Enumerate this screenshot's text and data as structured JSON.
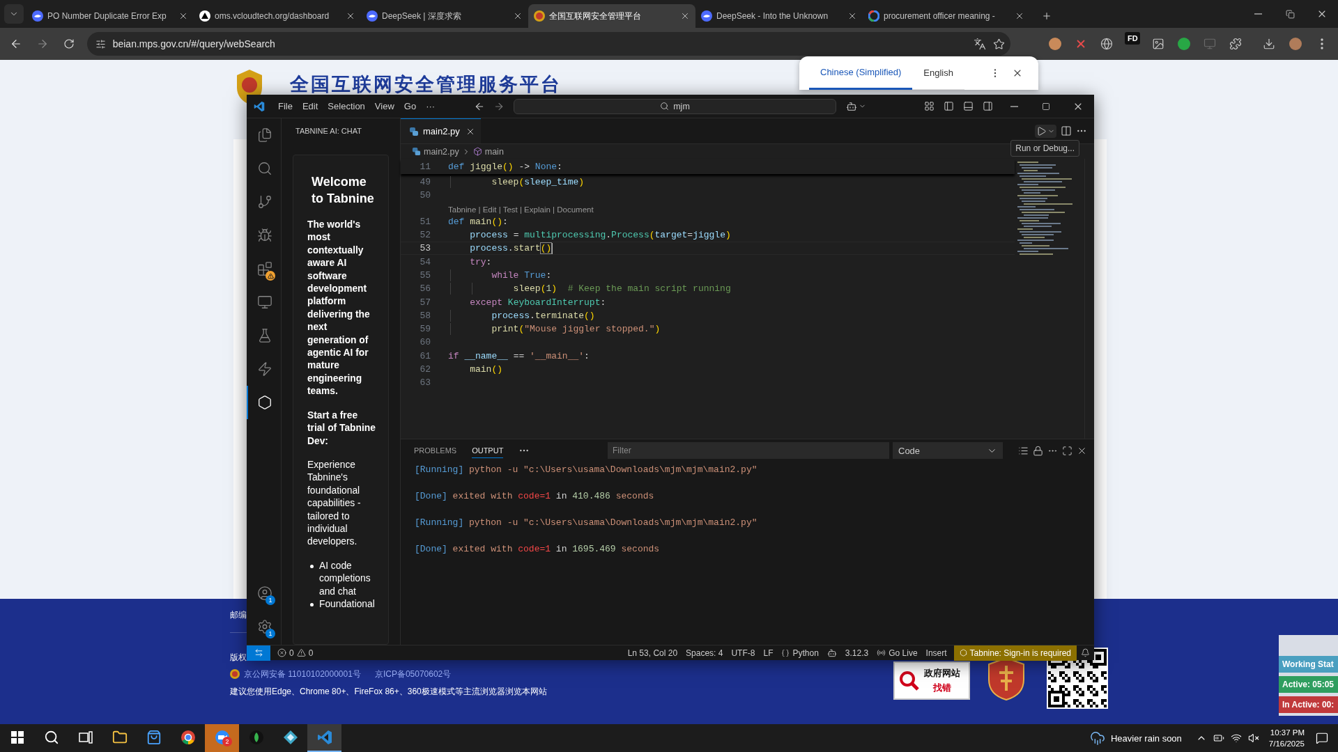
{
  "browser": {
    "tabs": [
      {
        "kind": "deepseek",
        "title": "PO Number Duplicate Error Exp",
        "selected": false
      },
      {
        "kind": "triangle",
        "title": "oms.vcloudtech.org/dashboard",
        "selected": false
      },
      {
        "kind": "deepseek",
        "title": "DeepSeek | 深度求索",
        "selected": false
      },
      {
        "kind": "emblem",
        "title": "全国互联网安全管理平台",
        "selected": true
      },
      {
        "kind": "deepseek",
        "title": "DeepSeek - Into the Unknown",
        "selected": false
      },
      {
        "kind": "google",
        "title": "procurement officer meaning -",
        "selected": false
      }
    ],
    "url": "beian.mps.gov.cn/#/query/webSearch",
    "extension_label": "FD"
  },
  "translate_popup": {
    "languages": [
      {
        "label": "Chinese (Simplified)",
        "selected": true
      },
      {
        "label": "English",
        "selected": false
      }
    ]
  },
  "site": {
    "title": "全国互联网安全管理服务平台",
    "footer": {
      "postcode": "邮编",
      "copyright": "版权",
      "records": [
        "京公网安备 11010102000001号",
        "京ICP备05070602号"
      ],
      "advice": "建议您使用Edge、Chrome 80+、FireFox 86+、360极速模式等主流浏览器浏览本网站",
      "report_badge": [
        "政府网站",
        "找错"
      ]
    }
  },
  "vscode": {
    "menu": [
      "File",
      "Edit",
      "Selection",
      "View",
      "Go",
      "···"
    ],
    "search": "mjm",
    "activity": [
      {
        "kind": "files",
        "selected": false,
        "warning": false
      },
      {
        "kind": "search",
        "selected": false,
        "warning": false
      },
      {
        "kind": "source-control",
        "selected": false,
        "warning": false
      },
      {
        "kind": "run-debug",
        "selected": false,
        "warning": false
      },
      {
        "kind": "extensions",
        "selected": false,
        "warning": true
      },
      {
        "kind": "remote",
        "selected": false,
        "warning": false
      },
      {
        "kind": "testing",
        "selected": false,
        "warning": false
      },
      {
        "kind": "lightning",
        "selected": false,
        "warning": false
      },
      {
        "kind": "tabnine",
        "selected": true,
        "warning": false
      }
    ],
    "accounts": [
      {
        "kind": "account",
        "badge": "1"
      },
      {
        "kind": "settings",
        "badge": "1"
      }
    ],
    "sidebar": {
      "title": "TABNINE AI: CHAT",
      "heading": "Welcome to Tabnine",
      "intro": "The world's most contextually aware AI software development platform delivering the next generation of agentic AI for mature engineering teams.",
      "trial": "Start a free trial of Tabnine Dev:",
      "description": "Experience Tabnine's foundational capabilities - tailored to individual developers.",
      "bullets": [
        "AI code completions and chat",
        "Foundational"
      ]
    },
    "editor_tabs": [
      {
        "label": "main2.py",
        "selected": true
      }
    ],
    "tooltip": "Run or Debug...",
    "breadcrumb": [
      "main2.py",
      "main"
    ],
    "sticky_line": {
      "number": "11",
      "tokens": [
        {
          "t": "def ",
          "kind": "kw"
        },
        {
          "t": "jiggle",
          "kind": "fn"
        },
        {
          "t": "()",
          "kind": "br"
        },
        {
          "t": " -> ",
          "kind": "p"
        },
        {
          "t": "None",
          "kind": "kw"
        },
        {
          "t": ":",
          "kind": "p"
        }
      ]
    },
    "lines": [
      {
        "kind": "code",
        "number": "49",
        "current": false,
        "tokens": [
          {
            "t": "        sleep",
            "kind": "fn"
          },
          {
            "t": "(",
            "kind": "br"
          },
          {
            "t": "sleep_time",
            "kind": "var"
          },
          {
            "t": ")",
            "kind": "br"
          }
        ]
      },
      {
        "kind": "code",
        "number": "50",
        "current": false
      },
      {
        "kind": "codelens",
        "text": "Tabnine | Edit | Test | Explain | Document"
      },
      {
        "kind": "code",
        "number": "51",
        "current": false,
        "tokens": [
          {
            "t": "def ",
            "kind": "kw"
          },
          {
            "t": "main",
            "kind": "fn"
          },
          {
            "t": "()",
            "kind": "br"
          },
          {
            "t": ":",
            "kind": "p"
          }
        ]
      },
      {
        "kind": "code",
        "number": "52",
        "current": false,
        "tokens": [
          {
            "t": "    process",
            "kind": "var"
          },
          {
            "t": " = ",
            "kind": "p"
          },
          {
            "t": "multiprocessing",
            "kind": "cls"
          },
          {
            "t": ".",
            "kind": "p"
          },
          {
            "t": "Process",
            "kind": "cls"
          },
          {
            "t": "(",
            "kind": "br"
          },
          {
            "t": "target",
            "kind": "var"
          },
          {
            "t": "=",
            "kind": "p"
          },
          {
            "t": "jiggle",
            "kind": "var"
          },
          {
            "t": ")",
            "kind": "br"
          }
        ]
      },
      {
        "kind": "code",
        "number": "53",
        "current": true,
        "tokens": [
          {
            "t": "    process",
            "kind": "var"
          },
          {
            "t": ".",
            "kind": "p"
          },
          {
            "t": "start",
            "kind": "fn"
          },
          {
            "t": "()",
            "kind": "match"
          }
        ]
      },
      {
        "kind": "code",
        "number": "54",
        "current": false,
        "tokens": [
          {
            "t": "    try",
            "kind": "ctl"
          },
          {
            "t": ":",
            "kind": "p"
          }
        ]
      },
      {
        "kind": "code",
        "number": "55",
        "current": false,
        "tokens": [
          {
            "t": "        while ",
            "kind": "ctl"
          },
          {
            "t": "True",
            "kind": "kw"
          },
          {
            "t": ":",
            "kind": "p"
          }
        ]
      },
      {
        "kind": "code",
        "number": "56",
        "current": false,
        "tokens": [
          {
            "t": "            sleep",
            "kind": "fn"
          },
          {
            "t": "(",
            "kind": "br"
          },
          {
            "t": "1",
            "kind": "num"
          },
          {
            "t": ")",
            "kind": "br"
          },
          {
            "t": "  # Keep the main script running",
            "kind": "cm"
          }
        ]
      },
      {
        "kind": "code",
        "number": "57",
        "current": false,
        "tokens": [
          {
            "t": "    except ",
            "kind": "ctl"
          },
          {
            "t": "KeyboardInterrupt",
            "kind": "cls"
          },
          {
            "t": ":",
            "kind": "p"
          }
        ]
      },
      {
        "kind": "code",
        "number": "58",
        "current": false,
        "tokens": [
          {
            "t": "        process",
            "kind": "var"
          },
          {
            "t": ".",
            "kind": "p"
          },
          {
            "t": "terminate",
            "kind": "fn"
          },
          {
            "t": "()",
            "kind": "br"
          }
        ]
      },
      {
        "kind": "code",
        "number": "59",
        "current": false,
        "tokens": [
          {
            "t": "        print",
            "kind": "fn"
          },
          {
            "t": "(",
            "kind": "br"
          },
          {
            "t": "\"Mouse jiggler stopped.\"",
            "kind": "str"
          },
          {
            "t": ")",
            "kind": "br"
          }
        ]
      },
      {
        "kind": "code",
        "number": "60",
        "current": false
      },
      {
        "kind": "code",
        "number": "61",
        "current": false,
        "tokens": [
          {
            "t": "if ",
            "kind": "ctl"
          },
          {
            "t": "__name__",
            "kind": "var"
          },
          {
            "t": " == ",
            "kind": "p"
          },
          {
            "t": "'__main__'",
            "kind": "str"
          },
          {
            "t": ":",
            "kind": "p"
          }
        ]
      },
      {
        "kind": "code",
        "number": "62",
        "current": false,
        "tokens": [
          {
            "t": "    main",
            "kind": "fn"
          },
          {
            "t": "()",
            "kind": "br"
          }
        ]
      },
      {
        "kind": "code",
        "number": "63",
        "current": false
      }
    ],
    "panel": {
      "tabs": [
        {
          "label": "PROBLEMS",
          "selected": false
        },
        {
          "label": "OUTPUT",
          "selected": true
        }
      ],
      "filter_placeholder": "Filter",
      "channel": "Code",
      "output": [
        {
          "tokens": [
            {
              "t": "[Running]",
              "kind": "tag"
            },
            {
              "t": " python -u \"c:\\Users\\usama\\Downloads\\mjm\\mjm\\main2.py\"",
              "kind": "txt"
            }
          ]
        },
        {
          "tokens": [
            {
              "t": "[Done]",
              "kind": "tag"
            },
            {
              "t": " exited with ",
              "kind": "txt"
            },
            {
              "t": "code=1",
              "kind": "err"
            },
            {
              "t": " in ",
              "kind": "p"
            },
            {
              "t": "410.486",
              "kind": "num"
            },
            {
              "t": " seconds",
              "kind": "txt"
            }
          ]
        },
        {
          "tokens": [
            {
              "t": "[Running]",
              "kind": "tag"
            },
            {
              "t": " python -u \"c:\\Users\\usama\\Downloads\\mjm\\mjm\\main2.py\"",
              "kind": "txt"
            }
          ]
        },
        {
          "tokens": [
            {
              "t": "[Done]",
              "kind": "tag"
            },
            {
              "t": " exited with ",
              "kind": "txt"
            },
            {
              "t": "code=1",
              "kind": "err"
            },
            {
              "t": " in ",
              "kind": "p"
            },
            {
              "t": "1695.469",
              "kind": "num"
            },
            {
              "t": " seconds",
              "kind": "txt"
            }
          ]
        }
      ]
    },
    "status": {
      "errors": "0",
      "warnings": "0",
      "items": [
        {
          "kind": "plain",
          "text": "Ln 53, Col 20"
        },
        {
          "kind": "plain",
          "text": "Spaces: 4"
        },
        {
          "kind": "plain",
          "text": "UTF-8"
        },
        {
          "kind": "plain",
          "text": "LF"
        },
        {
          "kind": "language",
          "text": "Python"
        },
        {
          "kind": "copilot"
        },
        {
          "kind": "plain",
          "text": "3.12.3"
        },
        {
          "kind": "live",
          "text": "Go Live"
        },
        {
          "kind": "plain",
          "text": "Insert"
        }
      ],
      "tabnine": "Tabnine: Sign-in is required"
    }
  },
  "work_widget": [
    {
      "label": "Working Stat",
      "color": "#4a9fc0"
    },
    {
      "label": "Active: 05:05",
      "color": "#2f9e5f"
    },
    {
      "label": "In Active: 00:",
      "color": "#c0393b"
    }
  ],
  "taskbar": {
    "apps": [
      {
        "kind": "start",
        "active": false,
        "flashing": false
      },
      {
        "kind": "search",
        "active": false,
        "flashing": false
      },
      {
        "kind": "taskview",
        "active": false,
        "flashing": false
      },
      {
        "kind": "explorer",
        "active": false,
        "flashing": false
      },
      {
        "kind": "store",
        "active": false,
        "flashing": false
      },
      {
        "kind": "chrome",
        "active": false,
        "flashing": false
      },
      {
        "kind": "zoom",
        "active": false,
        "flashing": true,
        "badge": "2"
      },
      {
        "kind": "leaf",
        "active": false,
        "flashing": false
      },
      {
        "kind": "hex",
        "active": false,
        "flashing": false
      },
      {
        "kind": "vscode",
        "active": true,
        "flashing": false
      }
    ],
    "weather": "Heavier rain soon",
    "time": "10:37 PM",
    "date": "7/16/2025"
  }
}
